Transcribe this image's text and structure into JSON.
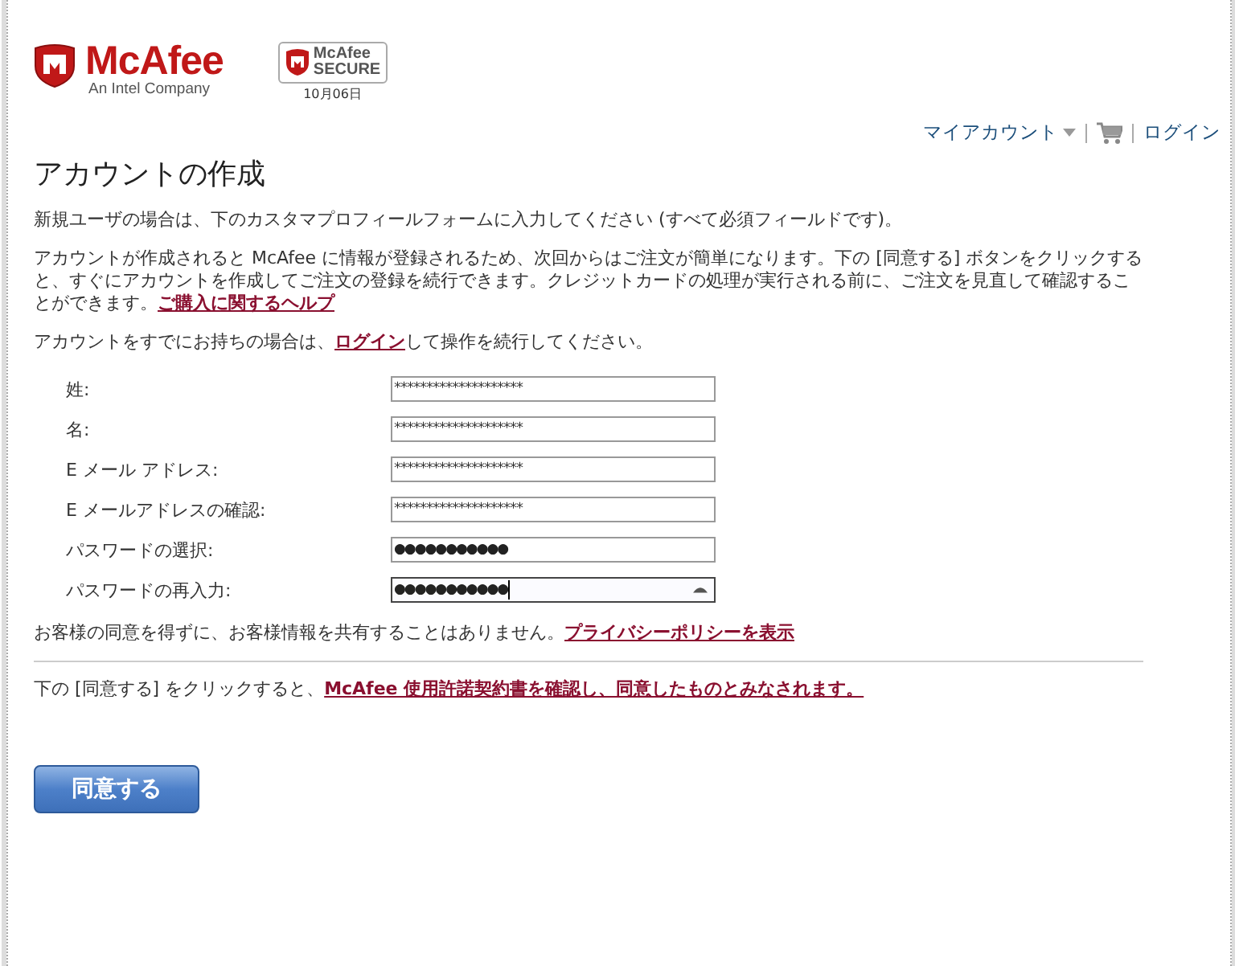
{
  "header": {
    "logo": {
      "name": "McAfee",
      "tagline": "An Intel Company"
    },
    "secure_badge": {
      "line_1": "McAfee",
      "line_2": "SECURE",
      "date": "10月06日"
    },
    "nav": [
      {
        "kind": "menu",
        "label": "マイアカウント"
      },
      {
        "kind": "cart"
      },
      {
        "kind": "link",
        "label": "ログイン"
      }
    ]
  },
  "title": "アカウントの作成",
  "paragraphs": [
    [
      {
        "kind": "text",
        "text": "新規ユーザの場合は、下のカスタマプロフィールフォームに入力してください (すべて必須フィールドです)。"
      }
    ],
    [
      {
        "kind": "text",
        "text": "アカウントが作成されると McAfee に情報が登録されるため、次回からはご注文が簡単になります。下の [同意する] ボタンをクリックすると、すぐにアカウントを作成してご注文の登録を続行できます。クレジットカードの処理が実行される前に、ご注文を見直して確認することができます。"
      },
      {
        "kind": "link",
        "text": "ご購入に関するヘルプ"
      }
    ],
    [
      {
        "kind": "text",
        "text": "アカウントをすでにお持ちの場合は、"
      },
      {
        "kind": "link",
        "text": "ログイン"
      },
      {
        "kind": "text",
        "text": "して操作を続行してください。"
      }
    ]
  ],
  "fields": [
    {
      "label": "姓:",
      "kind": "text",
      "value": "********************",
      "focused": false
    },
    {
      "label": "名:",
      "kind": "text",
      "value": "********************",
      "focused": false
    },
    {
      "label": "E メール アドレス:",
      "kind": "text",
      "value": "********************",
      "focused": false
    },
    {
      "label": "E メールアドレスの確認:",
      "kind": "text",
      "value": "********************",
      "focused": false
    },
    {
      "label": "パスワードの選択:",
      "kind": "password",
      "value": "●●●●●●●●●●●",
      "focused": false
    },
    {
      "label": "パスワードの再入力:",
      "kind": "password",
      "value": "●●●●●●●●●●●",
      "focused": true
    }
  ],
  "privacy": [
    {
      "kind": "text",
      "text": "お客様の同意を得ずに、お客様情報を共有することはありません。"
    },
    {
      "kind": "link",
      "text": "プライバシーポリシーを表示"
    }
  ],
  "agreement": [
    {
      "kind": "text",
      "text": "下の [同意する] をクリックすると、"
    },
    {
      "kind": "link",
      "text": "McAfee 使用許諾契約書を確認し、同意したものとみなされます。"
    }
  ],
  "submit_button": "同意する"
}
